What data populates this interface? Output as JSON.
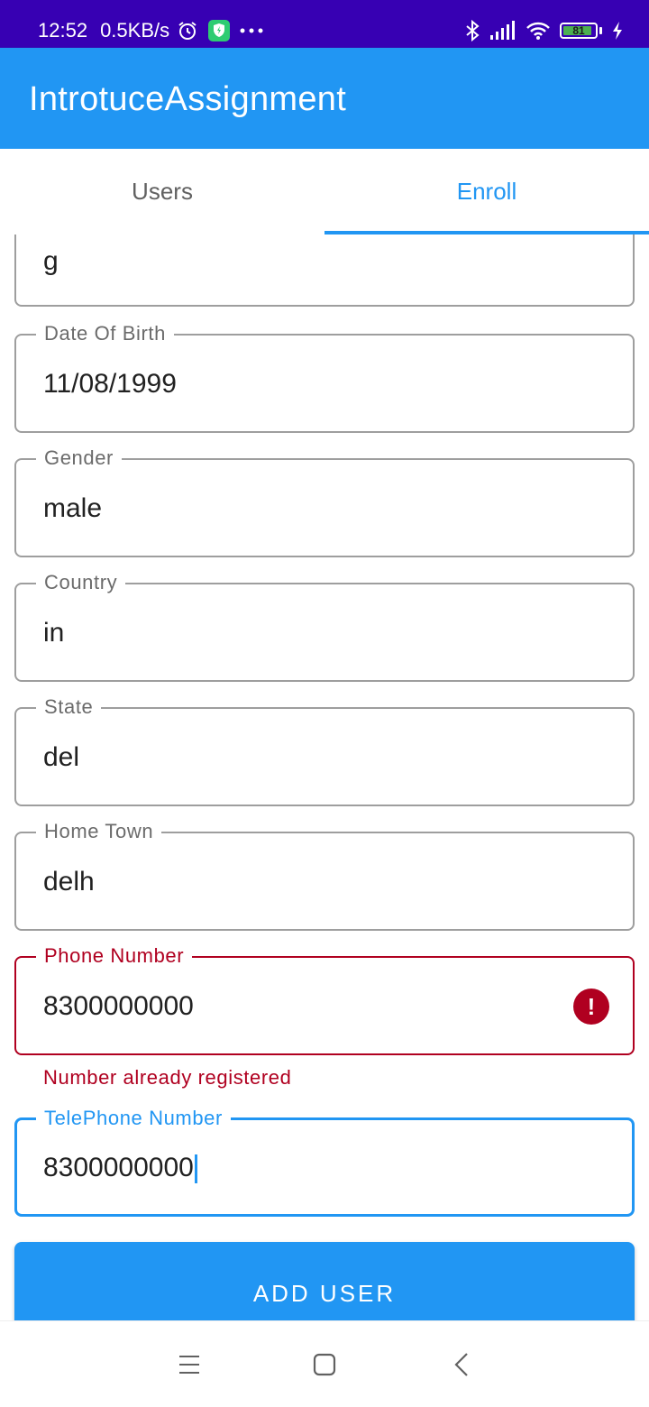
{
  "status_bar": {
    "time": "12:52",
    "speed": "0.5KB/s",
    "battery_level": "81",
    "icons": [
      "alarm-icon",
      "shield-app-icon",
      "more-dots-icon",
      "bluetooth-icon",
      "signal-icon",
      "wifi-icon",
      "battery-icon",
      "charging-icon"
    ]
  },
  "app_bar": {
    "title": "IntrotuceAssignment"
  },
  "tabs": [
    {
      "label": "Users",
      "active": false
    },
    {
      "label": "Enroll",
      "active": true
    }
  ],
  "form": {
    "partial_field": {
      "value": "g"
    },
    "fields": [
      {
        "label": "Date Of Birth",
        "value": "11/08/1999"
      },
      {
        "label": "Gender",
        "value": "male"
      },
      {
        "label": "Country",
        "value": "in"
      },
      {
        "label": "State",
        "value": "del"
      },
      {
        "label": "Home Town",
        "value": "delh"
      },
      {
        "label": "Phone Number",
        "value": "8300000000",
        "error": "Number already registered"
      },
      {
        "label": "TelePhone Number",
        "value": "8300000000"
      }
    ],
    "submit_label": "ADD USER"
  },
  "colors": {
    "primary": "#2196f3",
    "status_bar": "#3700b3",
    "error": "#b00020"
  }
}
